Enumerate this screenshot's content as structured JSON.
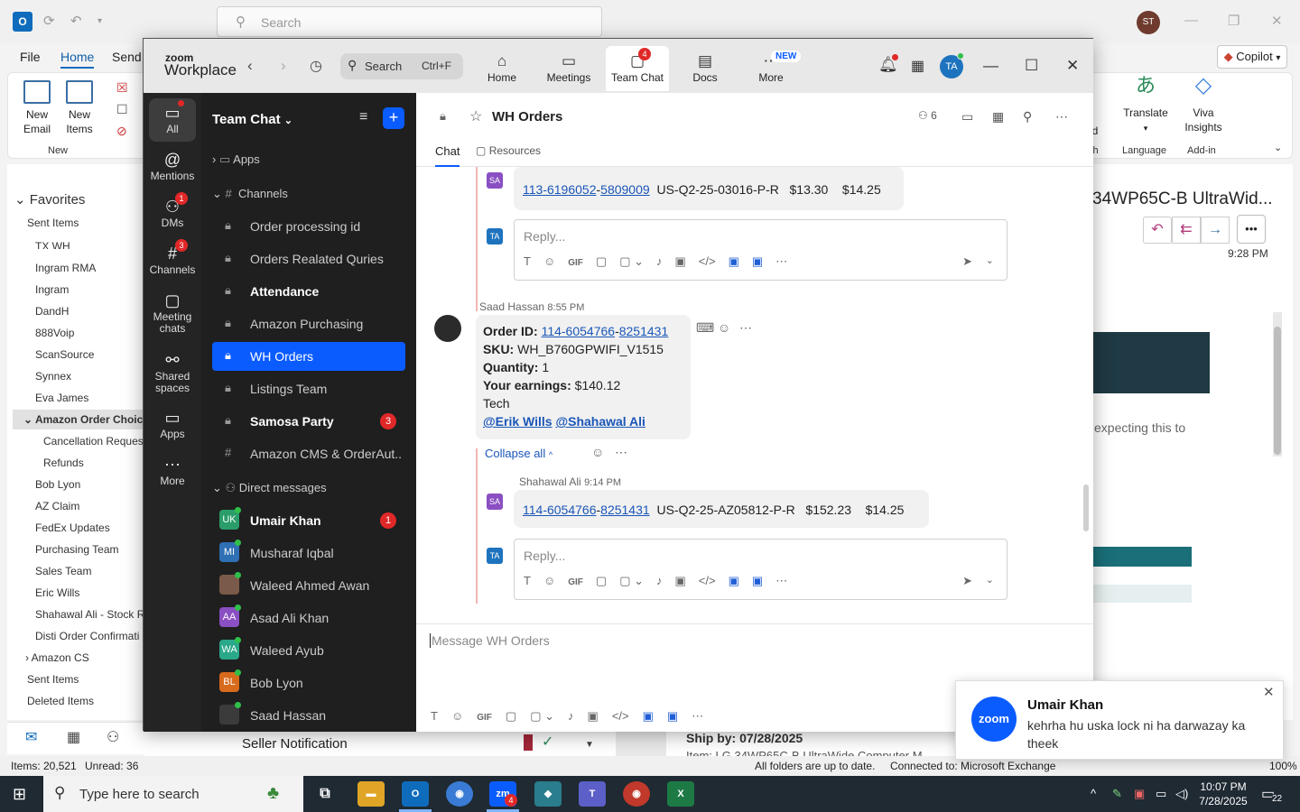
{
  "outlook": {
    "search_placeholder": "Search",
    "avatar": "ST",
    "menus": [
      "File",
      "Home",
      "Send"
    ],
    "copilot_label": "Copilot",
    "ribbon": {
      "new_email": "New Email",
      "new_items": "New Items",
      "group_new": "New",
      "translate": "Translate",
      "viva": "Viva Insights",
      "group_language": "Language",
      "group_addin": "Add-in",
      "partial_labels": [
        "d",
        "ud",
        "ch"
      ]
    },
    "folders": {
      "favorites": "Favorites",
      "items": [
        "Sent Items",
        "TX WH",
        "Ingram RMA",
        "Ingram",
        "DandH",
        "888Voip",
        "ScanSource",
        "Synnex",
        "Eva James",
        "Amazon Order Choice",
        "Cancellation Request",
        "Refunds",
        "Bob Lyon",
        "AZ Claim",
        "FedEx Updates",
        "Purchasing Team",
        "Sales Team",
        "Eric Wills",
        "Shahawal Ali - Stock R",
        "Disti Order Confirmati",
        "Amazon CS",
        "Sent Items",
        "Deleted Items"
      ]
    },
    "reading": {
      "subject": "34WP65C-B UltraWid...",
      "time": "9:28 PM",
      "snippet": "expecting this to"
    },
    "list_bottom": {
      "sender": "Seller Notification",
      "ship_by": "Ship by: 07/28/2025",
      "item_partial": "Item: LG 34WP65C-B UltraWide Computer M"
    },
    "status": {
      "items": "Items: 20,521",
      "unread": "Unread: 36",
      "folders": "All folders are up to date.",
      "connection": "Connected to: Microsoft Exchange",
      "zoom": "100%"
    }
  },
  "zoom": {
    "brand_top": "zoom",
    "brand_bottom": "Workplace",
    "search_label": "Search",
    "search_shortcut": "Ctrl+F",
    "tabs": [
      {
        "label": "Home",
        "icon": "home-icon"
      },
      {
        "label": "Meetings",
        "icon": "video-icon"
      },
      {
        "label": "Team Chat",
        "icon": "chat-icon",
        "badge": "4"
      },
      {
        "label": "Docs",
        "icon": "doc-icon"
      },
      {
        "label": "More",
        "icon": "more-icon",
        "badge": "NEW"
      }
    ],
    "user_initials": "TA",
    "rail": [
      {
        "label": "All"
      },
      {
        "label": "Mentions"
      },
      {
        "label": "DMs",
        "badge": "1"
      },
      {
        "label": "Channels",
        "badge": "3"
      },
      {
        "label": "Meeting chats"
      },
      {
        "label": "Shared spaces"
      },
      {
        "label": "Apps"
      },
      {
        "label": "More"
      }
    ],
    "list": {
      "title": "Team Chat",
      "apps": "Apps",
      "channels_header": "Channels",
      "channels": [
        {
          "name": "Order processing id"
        },
        {
          "name": "Orders Realated Quries"
        },
        {
          "name": "Attendance"
        },
        {
          "name": "Amazon Purchasing"
        },
        {
          "name": "WH Orders"
        },
        {
          "name": "Listings Team"
        },
        {
          "name": "Samosa Party",
          "count": "3"
        },
        {
          "name": "Amazon CMS & OrderAut..."
        }
      ],
      "dm_header": "Direct messages",
      "dms": [
        {
          "name": "Umair Khan",
          "initials": "UK",
          "color": "#2a9d6a",
          "count": "1"
        },
        {
          "name": "Musharaf Iqbal",
          "initials": "MI",
          "color": "#2f6fb3"
        },
        {
          "name": "Waleed Ahmed Awan",
          "initials": "",
          "color": "#7a5a4a"
        },
        {
          "name": "Asad Ali Khan",
          "initials": "AA",
          "color": "#8a4fc2"
        },
        {
          "name": "Waleed Ayub",
          "initials": "WA",
          "color": "#2aa88a"
        },
        {
          "name": "Bob Lyon",
          "initials": "BL",
          "color": "#d86a1c"
        },
        {
          "name": "Saad Hassan",
          "initials": "",
          "color": "#3b3b3b"
        }
      ]
    },
    "channel": {
      "name": "WH Orders",
      "members": "6",
      "tab_chat": "Chat",
      "tab_resources": "Resources"
    },
    "messages": {
      "top_reply": {
        "initials": "SA",
        "order_a": "113-6196052",
        "order_b": "5809009",
        "sku": "US-Q2-25-03016-P-R",
        "price1": "$13.30",
        "price2": "$14.25"
      },
      "reply_placeholder": "Reply...",
      "main": {
        "author": "Saad Hassan",
        "time": "8:55 PM",
        "order_label": "Order ID:",
        "order_a": "114-6054766",
        "order_b": "8251431",
        "sku_label": "SKU:",
        "sku": "WH_B760GPWIFI_V1515",
        "qty_label": "Quantity:",
        "qty": "1",
        "earn_label": "Your earnings:",
        "earn": "$140.12",
        "extra": "Tech",
        "mention1": "@Erik Wills",
        "mention2": "@Shahawal Ali"
      },
      "collapse": "Collapse all",
      "reply2": {
        "author": "Shahawal Ali",
        "time": "9:14 PM",
        "initials": "SA",
        "order_a": "114-6054766",
        "order_b": "8251431",
        "sku": "US-Q2-25-AZ05812-P-R",
        "price1": "$152.23",
        "price2": "$14.25"
      }
    },
    "composer_placeholder": "Message WH Orders"
  },
  "toast": {
    "logo": "zoom",
    "name": "Umair Khan",
    "message": "kehrha hu uska lock ni ha darwazay ka theek"
  },
  "taskbar": {
    "search_placeholder": "Type here to search",
    "time": "10:07 PM",
    "date": "7/28/2025",
    "zoom_badge": "4",
    "notifications": "22"
  }
}
